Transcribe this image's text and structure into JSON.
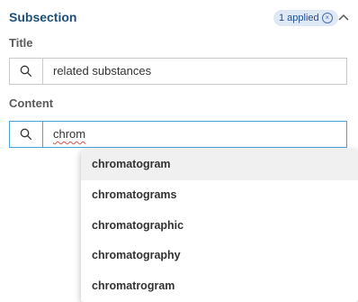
{
  "section": {
    "title": "Subsection",
    "applied_badge": "1 applied"
  },
  "title_field": {
    "label": "Title",
    "value": "related substances"
  },
  "content_field": {
    "label": "Content",
    "value": "chrom"
  },
  "suggestions": [
    "chromatogram",
    "chromatograms",
    "chromatographic",
    "chromatography",
    "chromatrogram"
  ],
  "icons": {
    "search": "search-icon",
    "collapse": "chevron-up-icon",
    "clear": "close-circle-icon"
  },
  "colors": {
    "section_title": "#1e4f7a",
    "badge_bg": "#dfe9f6",
    "active_border": "#4aa3df",
    "suggestion_highlight": "#f0f0f0"
  }
}
